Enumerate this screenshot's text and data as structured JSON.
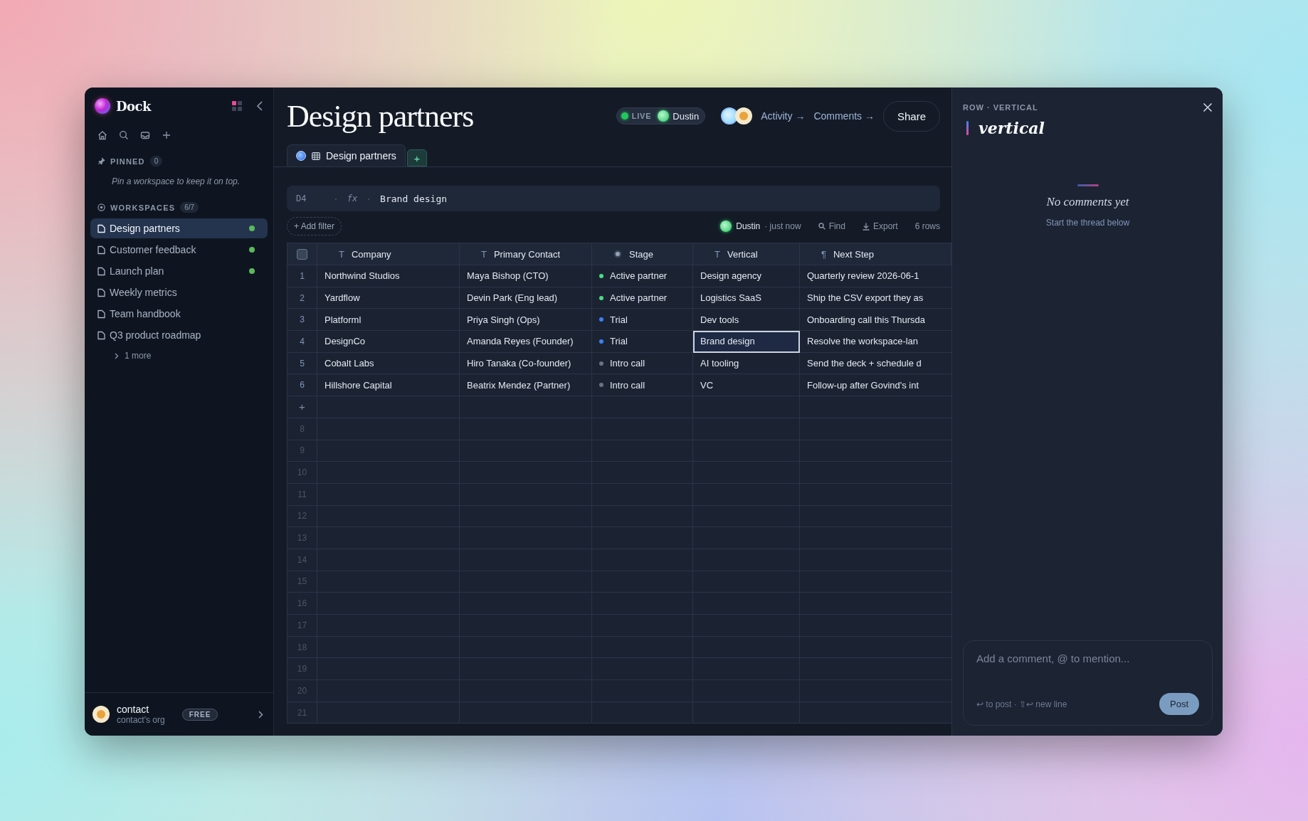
{
  "sidebar": {
    "app_name": "Dock",
    "pinned": {
      "label": "PINNED",
      "count": "0",
      "hint": "Pin a workspace to keep it on top."
    },
    "workspaces": {
      "label": "WORKSPACES",
      "count": "6/7",
      "items": [
        {
          "label": "Design partners",
          "selected": true,
          "live": true
        },
        {
          "label": "Customer feedback",
          "selected": false,
          "live": true
        },
        {
          "label": "Launch plan",
          "selected": false,
          "live": true
        },
        {
          "label": "Weekly metrics",
          "selected": false,
          "live": false
        },
        {
          "label": "Team handbook",
          "selected": false,
          "live": false
        },
        {
          "label": "Q3 product roadmap",
          "selected": false,
          "live": false
        }
      ],
      "more": "1 more"
    },
    "account": {
      "name": "contact",
      "org": "contact's org",
      "plan": "FREE"
    }
  },
  "header": {
    "title": "Design partners",
    "live_label": "LIVE",
    "live_user": "Dustin",
    "activity": "Activity →",
    "comments": "Comments →",
    "share": "Share"
  },
  "tabs": [
    {
      "label": "Design partners",
      "selected": true
    }
  ],
  "add_tab": "+",
  "formula_bar": {
    "cell": "D4",
    "separator": "·",
    "fx": "fx",
    "value": "Brand design"
  },
  "toolbar": {
    "add_filter": "+ Add filter",
    "presence_user": "Dustin",
    "presence_time": "· just now",
    "find": "Find",
    "export": "Export",
    "row_count": "6 rows"
  },
  "table": {
    "select_all": {
      "checked": false
    },
    "columns": [
      {
        "kind": "text",
        "icon": "T",
        "label": "Company"
      },
      {
        "kind": "text",
        "icon": "T",
        "label": "Primary Contact"
      },
      {
        "kind": "select",
        "label": "Stage"
      },
      {
        "kind": "text",
        "icon": "T",
        "label": "Vertical"
      },
      {
        "kind": "text",
        "icon": "¶",
        "label": "Next Step"
      }
    ],
    "rows": [
      {
        "number": "1",
        "company": "Northwind Studios",
        "contact": "Maya Bishop (CTO)",
        "stage": {
          "label": "Active partner",
          "color": "#4ade80"
        },
        "vertical": {
          "text": "Design agency",
          "selected": false
        },
        "next_step": "Quarterly review 2026-06-1"
      },
      {
        "number": "2",
        "company": "Yardflow",
        "contact": "Devin Park (Eng lead)",
        "stage": {
          "label": "Active partner",
          "color": "#4ade80"
        },
        "vertical": {
          "text": "Logistics SaaS",
          "selected": false
        },
        "next_step": "Ship the CSV export they as"
      },
      {
        "number": "3",
        "company": "Platforml",
        "contact": "Priya Singh (Ops)",
        "stage": {
          "label": "Trial",
          "color": "#3b82f6"
        },
        "vertical": {
          "text": "Dev tools",
          "selected": false
        },
        "next_step": "Onboarding call this Thursda"
      },
      {
        "number": "4",
        "company": "DesignCo",
        "contact": "Amanda Reyes (Founder)",
        "stage": {
          "label": "Trial",
          "color": "#3b82f6"
        },
        "vertical": {
          "text": "Brand design",
          "selected": true
        },
        "next_step": "Resolve the workspace-lan"
      },
      {
        "number": "5",
        "company": "Cobalt Labs",
        "contact": "Hiro Tanaka (Co-founder)",
        "stage": {
          "label": "Intro call",
          "color": "#6b7280"
        },
        "vertical": {
          "text": "AI tooling",
          "selected": false
        },
        "next_step": "Send the deck + schedule d"
      },
      {
        "number": "6",
        "company": "Hillshore Capital",
        "contact": "Beatrix Mendez (Partner)",
        "stage": {
          "label": "Intro call",
          "color": "#6b7280"
        },
        "vertical": {
          "text": "VC",
          "selected": false
        },
        "next_step": "Follow-up after Govind's int"
      }
    ],
    "add_row": "+",
    "empty_rows": [
      "8",
      "9",
      "10",
      "11",
      "12",
      "13",
      "14",
      "15",
      "16",
      "17",
      "18",
      "19",
      "20",
      "21"
    ]
  },
  "panel": {
    "breadcrumb": "ROW · VERTICAL",
    "title": "vertical",
    "empty_title": "No comments yet",
    "empty_hint": "Start the thread below",
    "comment": {
      "placeholder": "Add a comment, @ to mention...",
      "hint": "↩ to post · ⇧↩ new line",
      "post": "Post"
    }
  }
}
